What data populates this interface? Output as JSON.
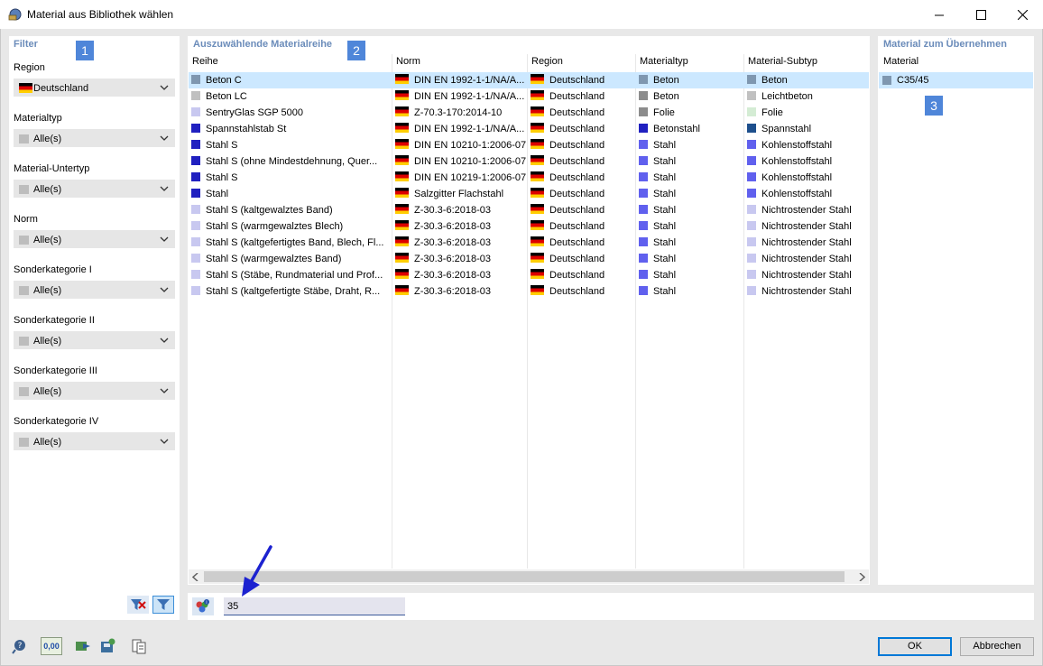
{
  "window": {
    "title": "Material aus Bibliothek wählen"
  },
  "filter": {
    "title": "Filter",
    "badge": "1",
    "fields": [
      {
        "label": "Region",
        "value": "Deutschland",
        "flag": true
      },
      {
        "label": "Materialtyp",
        "value": "Alle(s)"
      },
      {
        "label": "Material-Untertyp",
        "value": "Alle(s)"
      },
      {
        "label": "Norm",
        "value": "Alle(s)"
      },
      {
        "label": "Sonderkategorie I",
        "value": "Alle(s)"
      },
      {
        "label": "Sonderkategorie II",
        "value": "Alle(s)"
      },
      {
        "label": "Sonderkategorie III",
        "value": "Alle(s)"
      },
      {
        "label": "Sonderkategorie IV",
        "value": "Alle(s)"
      }
    ]
  },
  "materials": {
    "title": "Auszuwählende Materialreihe",
    "badge": "2",
    "columns": [
      "Reihe",
      "Norm",
      "Region",
      "Materialtyp",
      "Material-Subtyp"
    ],
    "rows": [
      {
        "reihe": "Beton C",
        "reihe_color": "#7f97b0",
        "norm": "DIN EN 1992-1-1/NA/A...",
        "region": "Deutschland",
        "typ": "Beton",
        "typ_color": "#7f97b0",
        "subtyp": "Beton",
        "subtyp_color": "#7f97b0",
        "selected": true
      },
      {
        "reihe": "Beton LC",
        "reihe_color": "#c0c0c0",
        "norm": "DIN EN 1992-1-1/NA/A...",
        "region": "Deutschland",
        "typ": "Beton",
        "typ_color": "#8c8c8c",
        "subtyp": "Leichtbeton",
        "subtyp_color": "#c0c0c0"
      },
      {
        "reihe": "SentryGlas SGP 5000",
        "reihe_color": "#c8c8f0",
        "norm": "Z-70.3-170:2014-10",
        "region": "Deutschland",
        "typ": "Folie",
        "typ_color": "#8c8c8c",
        "subtyp": "Folie",
        "subtyp_color": "#d4ecd4"
      },
      {
        "reihe": "Spannstahlstab St",
        "reihe_color": "#2020c0",
        "norm": "DIN EN 1992-1-1/NA/A...",
        "region": "Deutschland",
        "typ": "Betonstahl",
        "typ_color": "#2020c0",
        "subtyp": "Spannstahl",
        "subtyp_color": "#1d4f8c"
      },
      {
        "reihe": "Stahl S",
        "reihe_color": "#2020c0",
        "norm": "DIN EN 10210-1:2006-07",
        "region": "Deutschland",
        "typ": "Stahl",
        "typ_color": "#6060ee",
        "subtyp": "Kohlenstoffstahl",
        "subtyp_color": "#6060ee"
      },
      {
        "reihe": "Stahl S (ohne Mindestdehnung, Quer...",
        "reihe_color": "#2020c0",
        "norm": "DIN EN 10210-1:2006-07",
        "region": "Deutschland",
        "typ": "Stahl",
        "typ_color": "#6060ee",
        "subtyp": "Kohlenstoffstahl",
        "subtyp_color": "#6060ee"
      },
      {
        "reihe": "Stahl S",
        "reihe_color": "#2020c0",
        "norm": "DIN EN 10219-1:2006-07",
        "region": "Deutschland",
        "typ": "Stahl",
        "typ_color": "#6060ee",
        "subtyp": "Kohlenstoffstahl",
        "subtyp_color": "#6060ee"
      },
      {
        "reihe": "Stahl",
        "reihe_color": "#2020c0",
        "norm": "Salzgitter Flachstahl",
        "region": "Deutschland",
        "typ": "Stahl",
        "typ_color": "#6060ee",
        "subtyp": "Kohlenstoffstahl",
        "subtyp_color": "#6060ee"
      },
      {
        "reihe": "Stahl S (kaltgewalztes Band)",
        "reihe_color": "#c8c8f0",
        "norm": "Z-30.3-6:2018-03",
        "region": "Deutschland",
        "typ": "Stahl",
        "typ_color": "#6060ee",
        "subtyp": "Nichtrostender Stahl",
        "subtyp_color": "#c8c8f0"
      },
      {
        "reihe": "Stahl S (warmgewalztes Blech)",
        "reihe_color": "#c8c8f0",
        "norm": "Z-30.3-6:2018-03",
        "region": "Deutschland",
        "typ": "Stahl",
        "typ_color": "#6060ee",
        "subtyp": "Nichtrostender Stahl",
        "subtyp_color": "#c8c8f0"
      },
      {
        "reihe": "Stahl S (kaltgefertigtes Band, Blech, Fl...",
        "reihe_color": "#c8c8f0",
        "norm": "Z-30.3-6:2018-03",
        "region": "Deutschland",
        "typ": "Stahl",
        "typ_color": "#6060ee",
        "subtyp": "Nichtrostender Stahl",
        "subtyp_color": "#c8c8f0"
      },
      {
        "reihe": "Stahl S (warmgewalztes Band)",
        "reihe_color": "#c8c8f0",
        "norm": "Z-30.3-6:2018-03",
        "region": "Deutschland",
        "typ": "Stahl",
        "typ_color": "#6060ee",
        "subtyp": "Nichtrostender Stahl",
        "subtyp_color": "#c8c8f0"
      },
      {
        "reihe": "Stahl S (Stäbe, Rundmaterial und Prof...",
        "reihe_color": "#c8c8f0",
        "norm": "Z-30.3-6:2018-03",
        "region": "Deutschland",
        "typ": "Stahl",
        "typ_color": "#6060ee",
        "subtyp": "Nichtrostender Stahl",
        "subtyp_color": "#c8c8f0"
      },
      {
        "reihe": "Stahl S (kaltgefertigte Stäbe, Draht, R...",
        "reihe_color": "#c8c8f0",
        "norm": "Z-30.3-6:2018-03",
        "region": "Deutschland",
        "typ": "Stahl",
        "typ_color": "#6060ee",
        "subtyp": "Nichtrostender Stahl",
        "subtyp_color": "#c8c8f0"
      }
    ]
  },
  "search": {
    "value": "35"
  },
  "selection": {
    "title": "Material zum Übernehmen",
    "badge": "3",
    "column": "Material",
    "items": [
      {
        "label": "C35/45",
        "color": "#7f97b0"
      }
    ]
  },
  "buttons": {
    "ok": "OK",
    "cancel": "Abbrechen"
  },
  "toolbar": {
    "units_label": "0,00"
  },
  "colors": {
    "accent": "#4f86d9",
    "selection_bg": "#cce8ff",
    "title_blue": "#6b8cba"
  }
}
